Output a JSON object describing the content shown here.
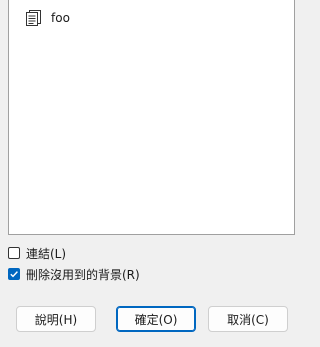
{
  "list": {
    "items": [
      {
        "label": "foo",
        "icon": "document-icon"
      }
    ]
  },
  "options": {
    "link_label": "連結(L)",
    "link_checked": false,
    "delete_label": "刪除沒用到的背景(R)",
    "delete_checked": true
  },
  "buttons": {
    "help_label": "說明(H)",
    "ok_label": "確定(O)",
    "cancel_label": "取消(C)"
  },
  "colors": {
    "accent": "#0067c0",
    "background": "#f0f0f0"
  }
}
